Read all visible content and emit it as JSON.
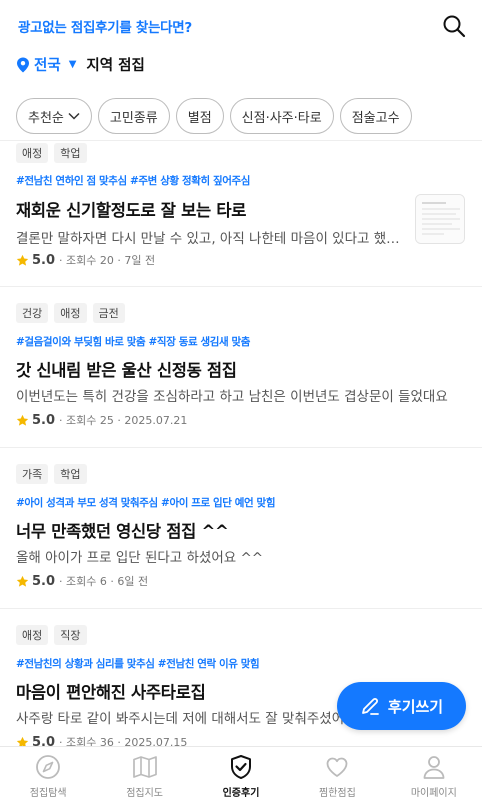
{
  "header": {
    "promo_text": "광고없는 점집후기를 찾는다면?",
    "location_name": "전국",
    "location_caret": "▼",
    "section_title": "지역 점집"
  },
  "filters": [
    {
      "label": "추천순",
      "has_dropdown": true
    },
    {
      "label": "고민종류"
    },
    {
      "label": "별점"
    },
    {
      "label": "신점·사주·타로"
    },
    {
      "label": "점술고수"
    }
  ],
  "reviews": [
    {
      "tags": [
        "애정",
        "학업"
      ],
      "hashtags": "#전남친 연하인 점 맞추심 #주변 상황 정확히 짚어주심",
      "title": "재회운 신기할정도로 잘 보는 타로",
      "description": "결론만 말하자면 다시 만날 수 있고, 아직 나한테 마음이 있다고 했어요",
      "rating": "5.0",
      "meta": "· 조회수 20 · 7일 전",
      "has_thumbnail": true
    },
    {
      "tags": [
        "건강",
        "애정",
        "금전"
      ],
      "hashtags": "#걸음걸이와 부딪힘 바로 맞춤 #직장 동료 생김새 맞춤",
      "title": "갓 신내림 받은 울산 신정동 점집",
      "description": "이번년도는 특히 건강을 조심하라고 하고 남친은 이번년도 겹상문이 들었대요",
      "rating": "5.0",
      "meta": "· 조회수 25 · 2025.07.21",
      "has_thumbnail": false
    },
    {
      "tags": [
        "가족",
        "학업"
      ],
      "hashtags": "#아이 성격과 부모 성격 맞춰주심 #아이 프로 입단 예언 맞힘",
      "title": "너무 만족했던 영신당 점집 ^^",
      "description": "올해 아이가 프로 입단 된다고 하셨어요 ^^",
      "rating": "5.0",
      "meta": "· 조회수 6 · 6일 전",
      "has_thumbnail": false
    },
    {
      "tags": [
        "애정",
        "직장"
      ],
      "hashtags": "#전남친의 상황과 심리를 맞추심 #전남친 연락 이유 맞힘",
      "title": "마음이 편안해진 사주타로집",
      "description": "사주랑 타로 같이 봐주시는데 저에 대해서도 잘 맞춰주셨어요",
      "rating": "5.0",
      "meta": "· 조회수 36 · 2025.07.15",
      "has_thumbnail": false
    }
  ],
  "write_button": {
    "label": "후기쓰기"
  },
  "tabbar": [
    {
      "label": "점집탐색",
      "icon": "compass-icon"
    },
    {
      "label": "점집지도",
      "icon": "map-icon"
    },
    {
      "label": "인증후기",
      "icon": "shield-check-icon",
      "active": true
    },
    {
      "label": "찜한점집",
      "icon": "heart-icon"
    },
    {
      "label": "마이페이지",
      "icon": "person-icon"
    }
  ],
  "colors": {
    "accent": "#1479ff",
    "star": "#f5b800"
  }
}
